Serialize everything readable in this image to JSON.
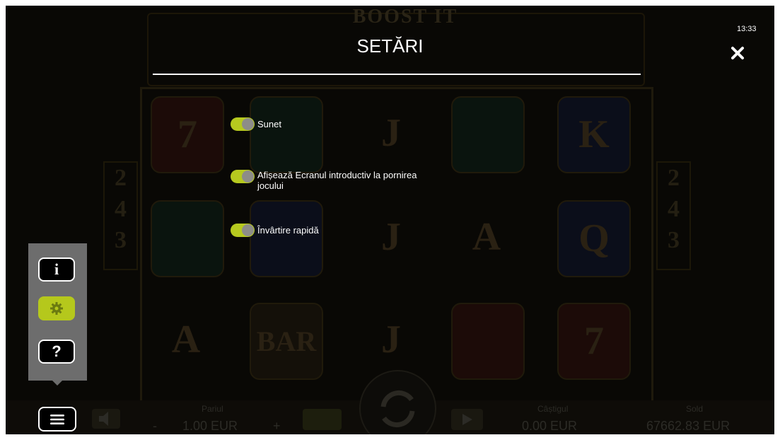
{
  "game": {
    "logo": "BOOST IT",
    "side_ways": [
      "2",
      "4",
      "3"
    ],
    "symbols": [
      "7",
      "J",
      "K",
      "J",
      "A",
      "Q",
      "A",
      "BAR",
      "J",
      "7"
    ],
    "bet_label": "Pariul",
    "bet_value": "1.00 EUR",
    "bet_minus": "-",
    "bet_plus": "+",
    "win_label": "Câștigul",
    "win_value": "0.00 EUR",
    "balance_label": "Sold",
    "balance_value": "67662.83 EUR"
  },
  "settings": {
    "title": "SETĂRI",
    "clock": "13:33",
    "options": [
      {
        "label": "Sunet",
        "enabled": true
      },
      {
        "label": "Afișează Ecranul introductiv la pornirea jocului",
        "enabled": true
      },
      {
        "label": "Învârtire rapidă",
        "enabled": true
      }
    ]
  },
  "menu": {
    "info_label": "i",
    "help_label": "?"
  },
  "colors": {
    "accent": "#b5c81c",
    "menu_bg": "#6d6d6d",
    "background": "#090805",
    "text": "#ffffff"
  },
  "icons": [
    "close-icon",
    "info-icon",
    "gear-icon",
    "help-icon",
    "hamburger-icon",
    "speaker-icon",
    "spin-icon",
    "play-icon"
  ]
}
